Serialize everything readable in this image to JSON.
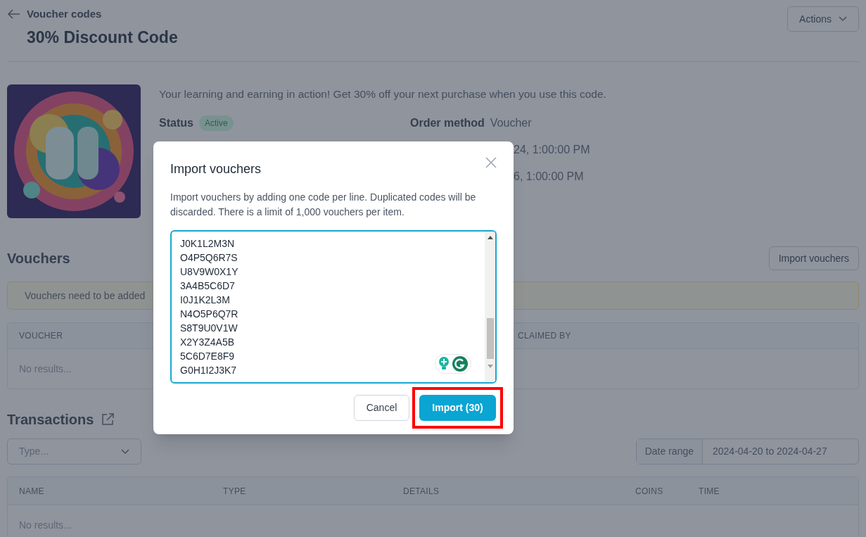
{
  "header": {
    "back_link": "Voucher codes",
    "title": "30% Discount Code",
    "actions_button": "Actions"
  },
  "details": {
    "description": "Your learning and earning in action! Get 30% off your next purchase when you use this code.",
    "status_label": "Status",
    "status_badge": "Active",
    "order_method_label": "Order method",
    "order_method_value": "Voucher",
    "dates": [
      "24, 1:00:00 PM",
      "6, 1:00:00 PM"
    ]
  },
  "vouchers": {
    "heading": "Vouchers",
    "import_button": "Import vouchers",
    "alert": "Vouchers need to be added",
    "columns": [
      "VOUCHER",
      "CLAIMED BY"
    ],
    "empty": "No results..."
  },
  "transactions": {
    "heading": "Transactions",
    "type_placeholder": "Type...",
    "date_range_label": "Date range",
    "date_range_value": "2024-04-20 to 2024-04-27",
    "columns": [
      "NAME",
      "TYPE",
      "DETAILS",
      "COINS",
      "TIME"
    ],
    "empty": "No results..."
  },
  "modal": {
    "title": "Import vouchers",
    "description": "Import vouchers by adding one code per line. Duplicated codes will be discarded. There is a limit of 1,000 vouchers per item.",
    "codes": [
      "J0K1L2M3N",
      "O4P5Q6R7S",
      "U8V9W0X1Y",
      "3A4B5C6D7",
      "I0J1K2L3M",
      "N4O5P6Q7R",
      "S8T9U0V1W",
      "X2Y3Z4A5B",
      "5C6D7E8F9",
      "G0H1I2J3K7"
    ],
    "cancel_button": "Cancel",
    "import_button": "Import (30)",
    "import_highlighted": true
  }
}
